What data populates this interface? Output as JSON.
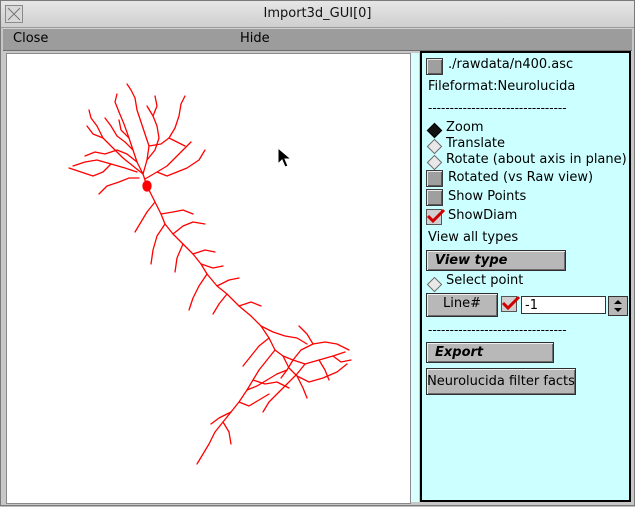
{
  "window": {
    "title": "Import3d_GUI[0]"
  },
  "menubar": {
    "close_label": "Close",
    "hide_label": "Hide"
  },
  "panel": {
    "file_path": "./rawdata/n400.asc",
    "file_format": "Fileformat:Neurolucida",
    "separator_1": "--------------------------------",
    "zoom_label": "Zoom",
    "translate_label": "Translate",
    "rotate_label": "Rotate (about axis in plane)",
    "rotated_label": "Rotated (vs Raw view)",
    "show_points_label": "Show Points",
    "show_diam_label": "ShowDiam",
    "view_all_types": "View all types",
    "view_type_button": "View type",
    "select_point_label": "Select point",
    "line_button": "Line#",
    "line_value": "-1",
    "separator_2": "--------------------------------",
    "export_button": "Export",
    "neurolucida_button": "Neurolucida filter facts"
  },
  "colors": {
    "neuron": "#ff0000",
    "panel_bg": "#ccffff"
  }
}
